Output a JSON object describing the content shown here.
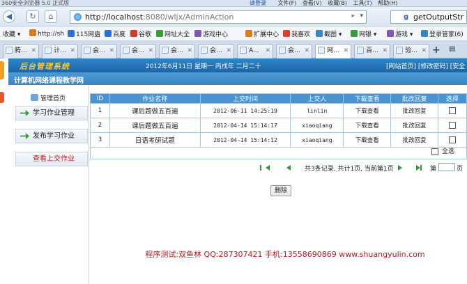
{
  "browser": {
    "title": "360安全浏览器 5.0 正式版",
    "menus": [
      "请登录",
      "文件(F)",
      "查看(V)",
      "收藏(B)",
      "工具(T)",
      "帮助(H)"
    ],
    "url_host": "http://localhost",
    "url_rest": ":8080/wljx/AdminAction",
    "search_text": "getOutputStr"
  },
  "favorites": [
    {
      "label": "收藏",
      "color": "#ffffff"
    },
    {
      "label": "http://sh",
      "color": "#e07a1f"
    },
    {
      "label": "115网盘",
      "color": "#2b6fd1"
    },
    {
      "label": "百度",
      "color": "#2b6fd1"
    },
    {
      "label": "谷歌",
      "color": "#d43b2e"
    },
    {
      "label": "网址大全",
      "color": "#3a9b3a"
    },
    {
      "label": "游戏中心",
      "color": "#7b5bb4"
    },
    {
      "label": "扩展中心",
      "color": "#e07a1f"
    },
    {
      "label": "我喜欢",
      "color": "#e0402e"
    },
    {
      "label": "截图",
      "color": "#3a86c4"
    },
    {
      "label": "网银",
      "color": "#3a9b3a"
    },
    {
      "label": "游戏",
      "color": "#7b5bb4"
    },
    {
      "label": "登录管家(6)",
      "color": "#3a86c4"
    }
  ],
  "tabs": [
    "腾...",
    "计...",
    "会...",
    "会...",
    "会...",
    "会...",
    "A...",
    "会...",
    "网...",
    "百...",
    "验..."
  ],
  "active_tab": 8,
  "app": {
    "logo": "后台管理系统",
    "date": "2012年6月11日 星期一 丙戌年 二月二十",
    "links": "[网站首页] [修改密码] [安全",
    "site_title": "计算机网络课程教学网"
  },
  "sidebar": {
    "title": "管理首页",
    "items": [
      {
        "label": "学习作业管理"
      },
      {
        "label": "发布学习作业"
      },
      {
        "label": "查看上交作业"
      }
    ]
  },
  "table": {
    "headers": [
      "ID",
      "作业名称",
      "上交时间",
      "上交人",
      "下载查看",
      "批改回复",
      "选择"
    ],
    "rows": [
      {
        "id": "1",
        "name": "课后题做五百遍",
        "time": "2012-06-11 14:25:19",
        "user": "linlin",
        "download": "下载查看",
        "reply": "批改回复"
      },
      {
        "id": "2",
        "name": "课后题做五百遍",
        "time": "2012-04-14 15:14:17",
        "user": "xiaoqiang",
        "download": "下载查看",
        "reply": "批改回复"
      },
      {
        "id": "3",
        "name": "日语考研试题",
        "time": "2012-04-14 15:14:12",
        "user": "xiaoqiang",
        "download": "下载查看",
        "reply": "批改回复"
      }
    ],
    "select_all": "全选"
  },
  "pager": {
    "info": "共3条记录, 共计1页, 当前第1页",
    "prefix": "第",
    "suffix": "页"
  },
  "delete_label": "删除",
  "footer": "程序测试:双鱼林 QQ:287307421 手机:13558690869 www.shuangyulin.com"
}
